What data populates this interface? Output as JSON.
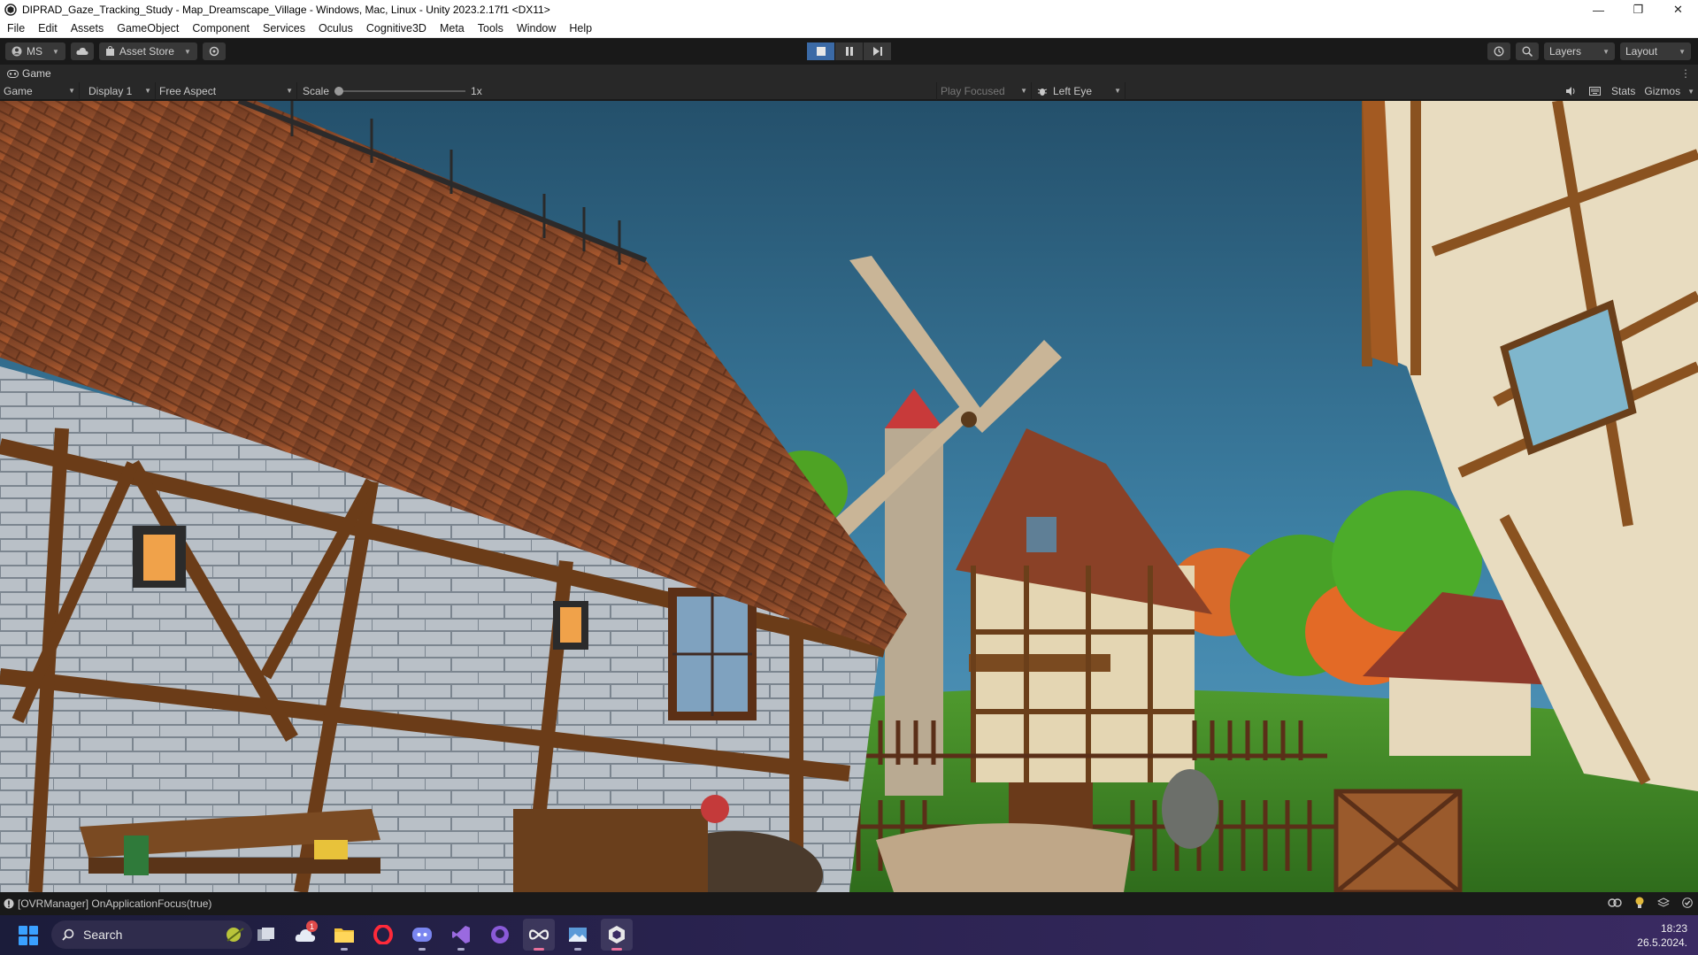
{
  "window": {
    "title": "DIPRAD_Gaze_Tracking_Study - Map_Dreamscape_Village - Windows, Mac, Linux - Unity 2023.2.17f1 <DX11>",
    "minimize": "—",
    "maximize": "❐",
    "close": "✕"
  },
  "menu": [
    "File",
    "Edit",
    "Assets",
    "GameObject",
    "Component",
    "Services",
    "Oculus",
    "Cognitive3D",
    "Meta",
    "Tools",
    "Window",
    "Help"
  ],
  "toolbar": {
    "account_label": "MS",
    "asset_store_label": "Asset Store",
    "layers_label": "Layers",
    "layout_label": "Layout",
    "play_state": "playing"
  },
  "game_tab": {
    "label": "Game"
  },
  "game_view": {
    "view_mode": "Game",
    "display": "Display 1",
    "aspect": "Free Aspect",
    "scale_label": "Scale",
    "scale_value": "1x",
    "scale_fraction": 0.0,
    "play_focus": "Play Focused",
    "eye": "Left Eye",
    "stats_label": "Stats",
    "gizmos_label": "Gizmos"
  },
  "console": {
    "message": "[OVRManager] OnApplicationFocus(true)"
  },
  "taskbar": {
    "search_placeholder": "Search",
    "apps": [
      "task-view",
      "weather",
      "file-explorer",
      "opera",
      "discord",
      "visual-studio",
      "github-desktop",
      "meta-quest-link",
      "photos",
      "unity"
    ],
    "weather_badge": "1",
    "time": "18:23",
    "date": "26.5.2024."
  },
  "colors": {
    "unity_bg": "#191919",
    "panel_bg": "#282828",
    "play_active": "#3b6aa6",
    "sky_top": "#25506a",
    "sky_bottom": "#4a8fb0"
  }
}
